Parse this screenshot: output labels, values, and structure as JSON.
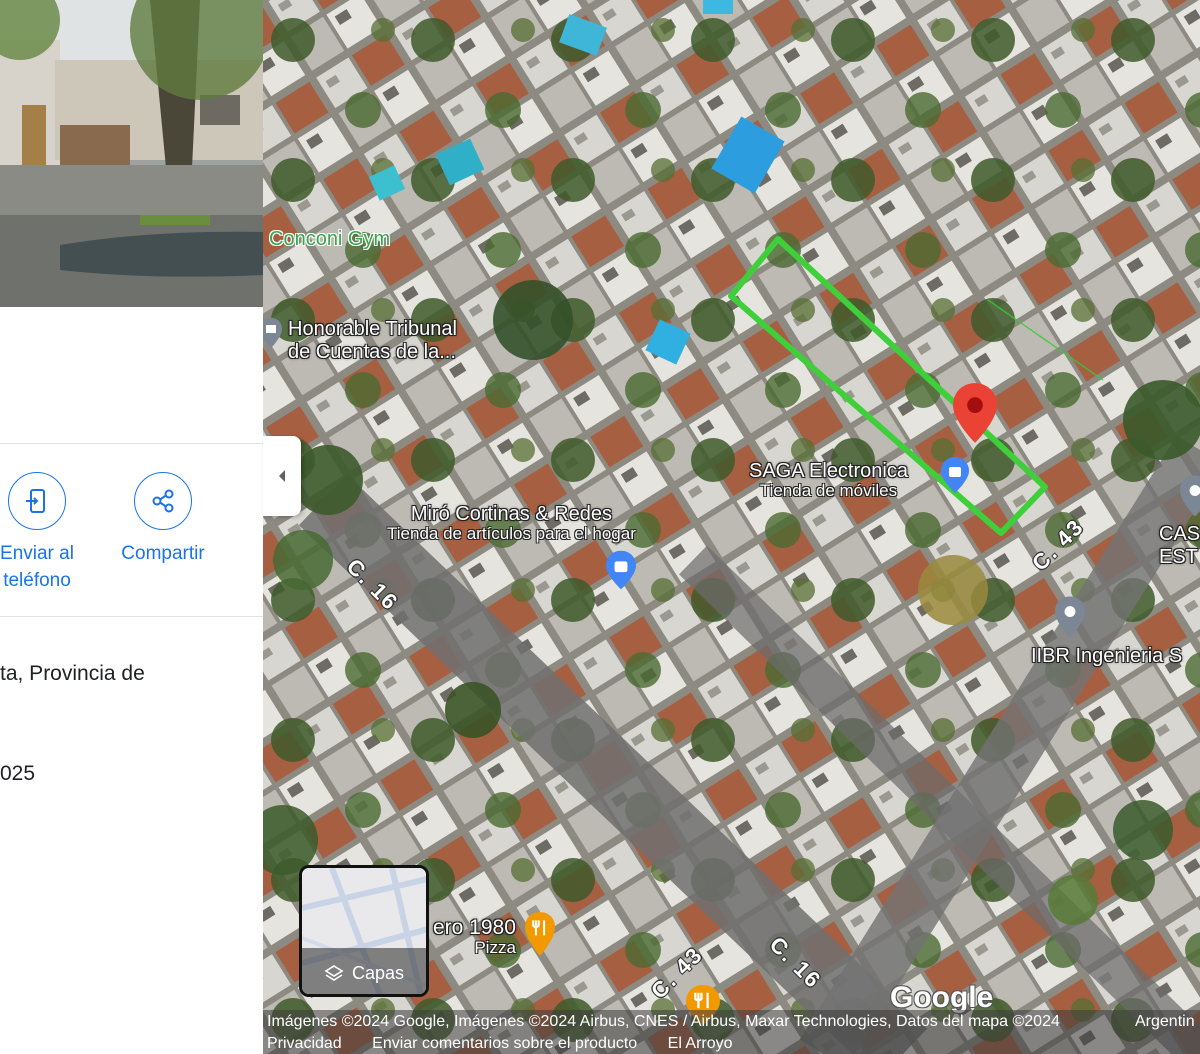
{
  "panel": {
    "actions": [
      {
        "label_line1": "Enviar al",
        "label_line2": "teléfono",
        "icon": "send-to-phone-icon"
      },
      {
        "label_line1": "Compartir",
        "icon": "share-icon"
      }
    ],
    "address_fragment": "ta, Provincia de",
    "year_fragment": "025"
  },
  "map": {
    "places": [
      {
        "name": "Conconi Gym"
      },
      {
        "name_line1": "Honorable Tribunal",
        "name_line2": "de Cuentas de la..."
      },
      {
        "name": "SAGA Electronica",
        "category": "Tienda de móviles"
      },
      {
        "name": "Miró Cortinas & Redes",
        "category": "Tienda de artículos para el hogar"
      },
      {
        "name": "IIBR Ingenieria S"
      },
      {
        "name_line1": "CAS",
        "name_line2": "EST"
      },
      {
        "name": "ero 1980",
        "category": "Pizza"
      }
    ],
    "streets": [
      "C. 16",
      "C. 43",
      "C. 43",
      "C. 16"
    ],
    "layers_label": "Capas",
    "logo": "Google",
    "colors": {
      "outline": "#3ecf3a",
      "pin": "#ea4335",
      "accent": "#1a73e8",
      "shop_pin": "#4285f4",
      "food_pin": "#f29900"
    }
  },
  "attribution": {
    "imagery": "Imágenes ©2024 Google, Imágenes ©2024 Airbus, CNES / Airbus, Maxar Technologies, Datos del mapa ©2024",
    "country": "Argentin",
    "links": [
      "Privacidad",
      "Enviar comentarios sobre el producto",
      "El Arroyo"
    ]
  }
}
